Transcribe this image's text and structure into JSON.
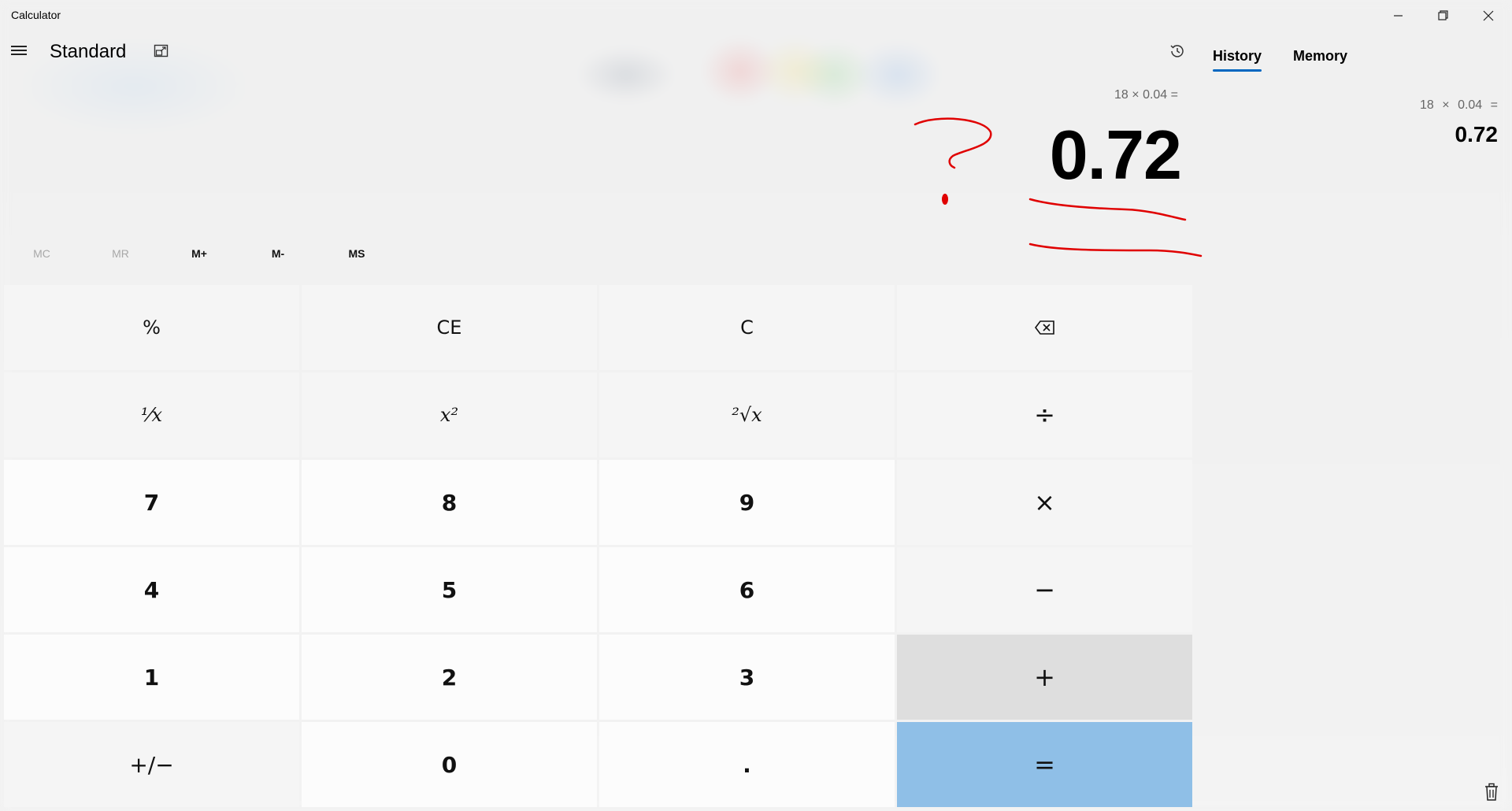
{
  "window": {
    "title": "Calculator",
    "minimize_icon": "minimize-icon",
    "maximize_icon": "restore-icon",
    "close_icon": "close-icon"
  },
  "header": {
    "mode": "Standard",
    "menu_icon": "hamburger-icon",
    "keep_on_top_icon": "keep-on-top-icon"
  },
  "display": {
    "expression": "18 × 0.04 =",
    "value": "0.72"
  },
  "memory": {
    "buttons": [
      {
        "label": "MC",
        "enabled": false
      },
      {
        "label": "MR",
        "enabled": false
      },
      {
        "label": "M+",
        "enabled": true
      },
      {
        "label": "M-",
        "enabled": true
      },
      {
        "label": "MS",
        "enabled": true
      }
    ]
  },
  "keypad": {
    "percent": "%",
    "ce": "CE",
    "c": "C",
    "backspace_icon": "backspace-icon",
    "reciprocal": "¹⁄x",
    "square": "x²",
    "sqrt": "²√x",
    "divide": "÷",
    "seven": "7",
    "eight": "8",
    "nine": "9",
    "multiply": "×",
    "four": "4",
    "five": "5",
    "six": "6",
    "minus": "−",
    "one": "1",
    "two": "2",
    "three": "3",
    "plus": "+",
    "negate": "+/−",
    "zero": "0",
    "decimal": ".",
    "equals": "="
  },
  "sidebar": {
    "history_icon": "history-icon",
    "tabs": [
      {
        "label": "History",
        "active": true
      },
      {
        "label": "Memory",
        "active": false
      }
    ],
    "history": [
      {
        "expression": "18 × 0.04 =",
        "result": "0.72"
      }
    ],
    "trash_icon": "trash-icon"
  },
  "colors": {
    "accent": "#0067c0",
    "equals_key": "#8fbfe7",
    "annotation": "#e00000"
  }
}
